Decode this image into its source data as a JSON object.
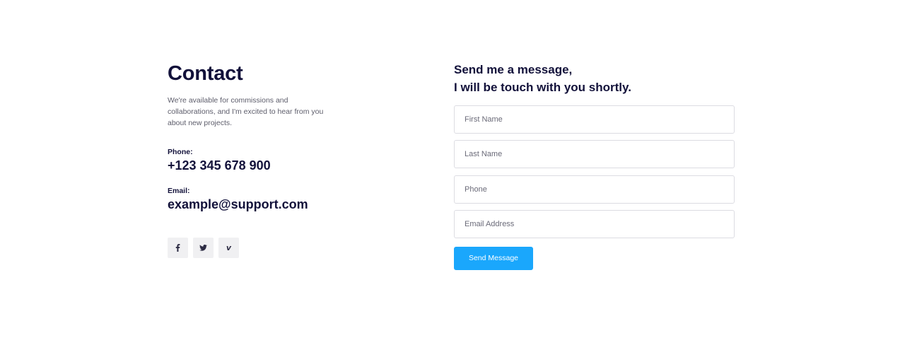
{
  "contact": {
    "title": "Contact",
    "description": "We're available for commissions and collaborations, and I'm excited to hear from you about new projects.",
    "phone_label": "Phone:",
    "phone_value": "+123 345 678 900",
    "email_label": "Email:",
    "email_value": "example@support.com",
    "social": [
      {
        "icon": "facebook-icon"
      },
      {
        "icon": "twitter-icon"
      },
      {
        "icon": "vimeo-icon",
        "glyph": "v"
      }
    ]
  },
  "form": {
    "heading_line1": "Send me a message,",
    "heading_line2": "I will be touch with you shortly.",
    "fields": {
      "first_name": {
        "placeholder": "First Name"
      },
      "last_name": {
        "placeholder": "Last Name"
      },
      "phone": {
        "placeholder": "Phone"
      },
      "email": {
        "placeholder": "Email Address"
      }
    },
    "submit_label": "Send Message"
  },
  "colors": {
    "heading": "#12113a",
    "body_text": "#5d5d6b",
    "accent": "#1aa7fc",
    "social_bg": "#f0f0f2",
    "field_border": "#dcdce2"
  }
}
